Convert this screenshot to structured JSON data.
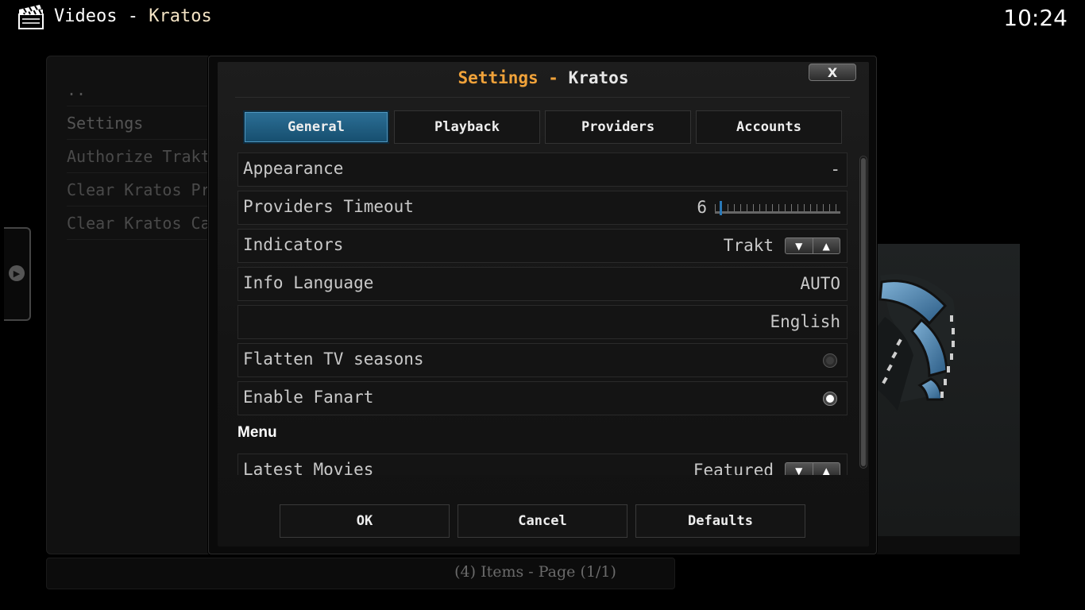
{
  "topbar": {
    "section": "Videos",
    "separator": "-",
    "addon": "Kratos",
    "clock": "10:24"
  },
  "background_list": {
    "items": [
      {
        "label": ".."
      },
      {
        "label": "Settings"
      },
      {
        "label": "Authorize Trakt"
      },
      {
        "label": "Clear Kratos Providers"
      },
      {
        "label": "Clear Kratos Cache"
      }
    ],
    "footer": "(4) Items - Page (1/1)"
  },
  "dialog": {
    "title_prefix": "Settings -",
    "title_addon": "Kratos",
    "close_label": "X",
    "tabs": [
      {
        "label": "General",
        "active": true
      },
      {
        "label": "Playback",
        "active": false
      },
      {
        "label": "Providers",
        "active": false
      },
      {
        "label": "Accounts",
        "active": false
      }
    ],
    "rows": {
      "appearance": {
        "label": "Appearance",
        "value": "-"
      },
      "providers_timeout": {
        "label": "Providers Timeout",
        "value": "6",
        "slider_level": 0.0
      },
      "indicators": {
        "label": "Indicators",
        "value": "Trakt"
      },
      "info_language": {
        "label": "Info Language",
        "value": "AUTO"
      },
      "language_secondary": {
        "label": "",
        "value": "English"
      },
      "flatten_tv": {
        "label": "Flatten TV seasons",
        "enabled": false
      },
      "enable_fanart": {
        "label": "Enable Fanart",
        "enabled": true
      },
      "latest_movies": {
        "label": "Latest Movies",
        "value": "Featured"
      }
    },
    "section_menu": "Menu",
    "buttons": {
      "ok": "OK",
      "cancel": "Cancel",
      "defaults": "Defaults"
    }
  },
  "icons": {
    "spin_down": "▼",
    "spin_up": "▲",
    "side_arrow": "▶"
  },
  "colors": {
    "accent_orange": "#f0a23a",
    "tab_active": "#2c6f96",
    "slider_nib": "#2a79b8"
  }
}
